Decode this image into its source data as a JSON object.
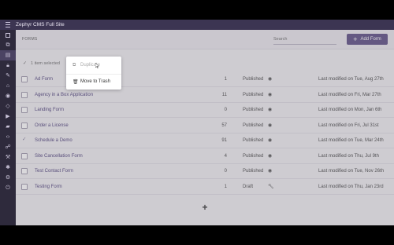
{
  "window": {
    "title": "Zephyr CMS Full Site"
  },
  "header": {
    "page_title": "FORMS",
    "search_placeholder": "Search",
    "add_button_label": "Add Form"
  },
  "selection": {
    "text": "1 item selected"
  },
  "popup_menu": {
    "items": [
      {
        "label": "Duplicate",
        "icon": "copy-icon",
        "disabled": true
      },
      {
        "label": "Move to Trash",
        "icon": "trash-icon",
        "disabled": false
      }
    ]
  },
  "table": {
    "rows": [
      {
        "name": "Ad Form",
        "count": "1",
        "status": "Published",
        "status_icon": "eye-icon",
        "modified": "Last modified on Tue, Aug 27th",
        "checked": false
      },
      {
        "name": "Agency in a Box Application",
        "count": "11",
        "status": "Published",
        "status_icon": "eye-icon",
        "modified": "Last modified on Fri, Mar 27th",
        "checked": false
      },
      {
        "name": "Landing Form",
        "count": "0",
        "status": "Published",
        "status_icon": "eye-icon",
        "modified": "Last modified on Mon, Jan 6th",
        "checked": false
      },
      {
        "name": "Order a License",
        "count": "57",
        "status": "Published",
        "status_icon": "eye-icon",
        "modified": "Last modified on Fri, Jul 31st",
        "checked": false
      },
      {
        "name": "Schedule a Demo",
        "count": "91",
        "status": "Published",
        "status_icon": "eye-icon",
        "modified": "Last modified on Tue, Mar 24th",
        "checked": true
      },
      {
        "name": "Site Cancellation Form",
        "count": "4",
        "status": "Published",
        "status_icon": "eye-icon",
        "modified": "Last modified on Thu, Jul 9th",
        "checked": false
      },
      {
        "name": "Test Contact Form",
        "count": "0",
        "status": "Published",
        "status_icon": "eye-icon",
        "modified": "Last modified on Tue, Nov 26th",
        "checked": false
      },
      {
        "name": "Testing Form",
        "count": "1",
        "status": "Draft",
        "status_icon": "wrench-icon",
        "modified": "Last modified on Thu, Jan 23rd",
        "checked": false
      }
    ]
  },
  "sidebar": {
    "icons": [
      "dashboard-icon",
      "pages-icon",
      "content-icon",
      "lock-icon",
      "edit-icon",
      "themes-icon",
      "eye-icon",
      "diamond-icon",
      "video-icon",
      "folder-icon",
      "code-icon",
      "sitemap-icon",
      "tools-icon",
      "bug-icon",
      "settings-icon",
      "power-icon"
    ],
    "active_index": 2
  },
  "colors": {
    "accent": "#6a5c8d",
    "titlebar": "#3c3552",
    "sidebar": "#2e2a3c",
    "link": "#5b4f84"
  }
}
